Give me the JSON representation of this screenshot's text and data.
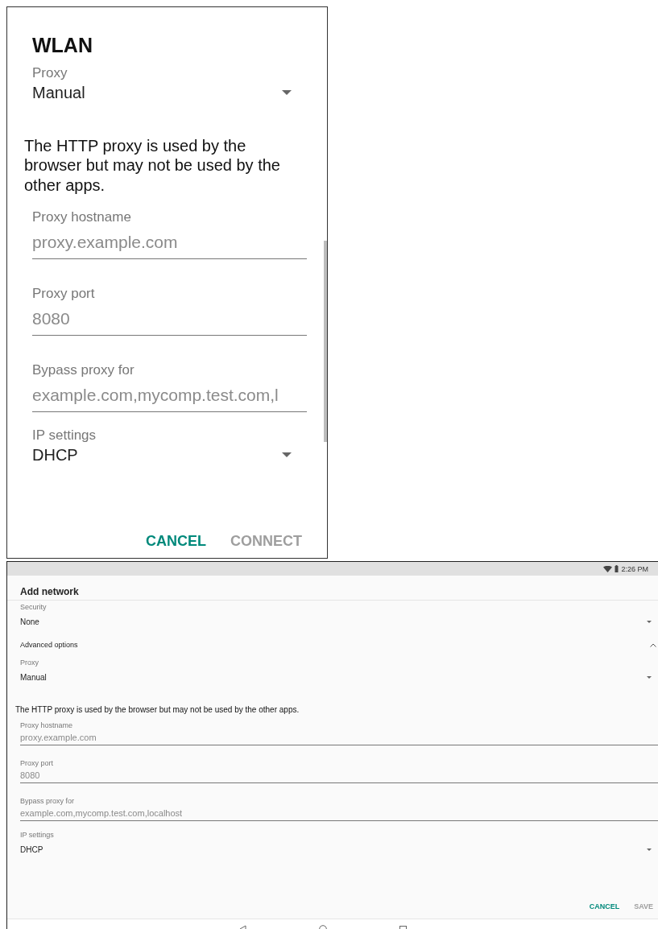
{
  "phone_dialog": {
    "title": "WLAN",
    "fields": [
      {
        "kind": "dropdown",
        "label": "Proxy",
        "value": "Manual"
      },
      {
        "kind": "note",
        "text": "The HTTP proxy is used by the browser but may not be used by the other apps."
      },
      {
        "kind": "input",
        "label": "Proxy hostname",
        "placeholder": "proxy.example.com"
      },
      {
        "kind": "input",
        "label": "Proxy port",
        "placeholder": "8080"
      },
      {
        "kind": "input",
        "label": "Bypass proxy for",
        "placeholder": "example.com,mycomp.test.com,l"
      },
      {
        "kind": "dropdown",
        "label": "IP settings",
        "value": "DHCP"
      }
    ],
    "buttons": [
      {
        "label": "CANCEL",
        "disabled": false
      },
      {
        "label": "CONNECT",
        "disabled": true
      }
    ]
  },
  "tablet_screen": {
    "status_bar": {
      "time": "2:26 PM"
    },
    "title": "Add network",
    "fields": [
      {
        "kind": "dropdown",
        "label": "Security",
        "value": "None"
      },
      {
        "kind": "expander",
        "label": "Advanced options",
        "expanded": true
      },
      {
        "kind": "dropdown",
        "label": "Proxy",
        "value": "Manual"
      },
      {
        "kind": "note",
        "text": "The HTTP proxy is used by the browser but may not be used by the other apps."
      },
      {
        "kind": "input",
        "label": "Proxy hostname",
        "placeholder": "proxy.example.com"
      },
      {
        "kind": "input",
        "label": "Proxy port",
        "placeholder": "8080"
      },
      {
        "kind": "input",
        "label": "Bypass proxy for",
        "placeholder": "example.com,mycomp.test.com,localhost"
      },
      {
        "kind": "dropdown",
        "label": "IP settings",
        "value": "DHCP"
      }
    ],
    "buttons": [
      {
        "label": "CANCEL",
        "disabled": false
      },
      {
        "label": "SAVE",
        "disabled": true
      }
    ]
  }
}
